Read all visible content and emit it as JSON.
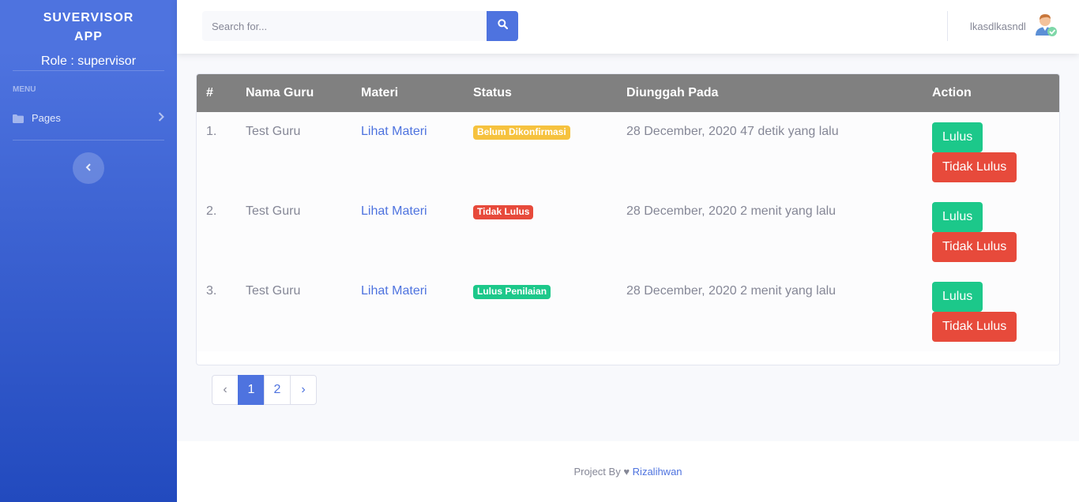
{
  "sidebar": {
    "brand_line1": "SUVERVISOR",
    "brand_line2": "APP",
    "role": "Role : supervisor",
    "menu_heading": "MENU",
    "items": [
      {
        "label": "Pages",
        "icon": "folder-icon"
      }
    ]
  },
  "topbar": {
    "search_placeholder": "Search for...",
    "username": "lkasdlkasndl"
  },
  "table": {
    "headers": [
      "#",
      "Nama Guru",
      "Materi",
      "Status",
      "Diunggah Pada",
      "Action"
    ],
    "rows": [
      {
        "no": "1.",
        "guru": "Test Guru",
        "materi": "Lihat Materi",
        "status": "Belum Dikonfirmasi",
        "status_color": "#f6c23e",
        "uploaded": "28 December, 2020 47 detik yang lalu",
        "btn_pass": "Lulus",
        "btn_fail": "Tidak Lulus"
      },
      {
        "no": "2.",
        "guru": "Test Guru",
        "materi": "Lihat Materi",
        "status": "Tidak Lulus",
        "status_color": "#e74a3b",
        "uploaded": "28 December, 2020 2 menit yang lalu",
        "btn_pass": "Lulus",
        "btn_fail": "Tidak Lulus"
      },
      {
        "no": "3.",
        "guru": "Test Guru",
        "materi": "Lihat Materi",
        "status": "Lulus Penilaian",
        "status_color": "#1cc88a",
        "uploaded": "28 December, 2020 2 menit yang lalu",
        "btn_pass": "Lulus",
        "btn_fail": "Tidak Lulus"
      }
    ]
  },
  "pagination": {
    "prev": "‹",
    "pages": [
      "1",
      "2"
    ],
    "active": "1",
    "next": "›"
  },
  "footer": {
    "prefix": "Project By",
    "heart": "♥",
    "author": "Rizalihwan"
  },
  "colors": {
    "primary": "#4e73df",
    "success": "#1cc88a",
    "danger": "#e74a3b",
    "warning": "#f6c23e",
    "table_header": "#808080"
  }
}
